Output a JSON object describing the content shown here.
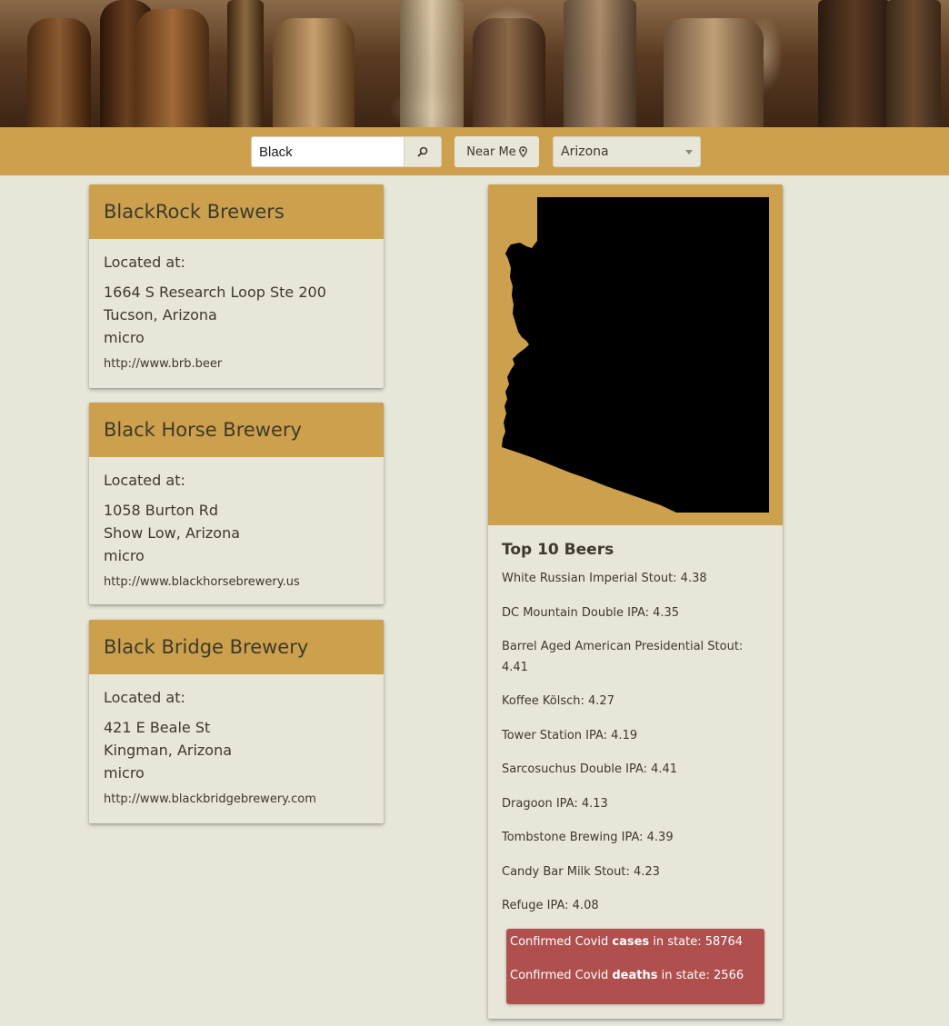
{
  "search": {
    "value": "Black"
  },
  "near_me": {
    "label": "Near Me"
  },
  "state_select": {
    "selected": "Arizona"
  },
  "breweries": [
    {
      "name": "BlackRock Brewers",
      "located_label": "Located at:",
      "street": "1664 S Research Loop Ste 200",
      "city_state": "Tucson, Arizona",
      "type": "micro",
      "url": "http://www.brb.beer"
    },
    {
      "name": "Black Horse Brewery",
      "located_label": "Located at:",
      "street": "1058 Burton Rd",
      "city_state": "Show Low, Arizona",
      "type": "micro",
      "url": "http://www.blackhorsebrewery.us"
    },
    {
      "name": "Black Bridge Brewery",
      "located_label": "Located at:",
      "street": "421 E Beale St",
      "city_state": "Kingman, Arizona",
      "type": "micro",
      "url": "http://www.blackbridgebrewery.com"
    }
  ],
  "state_panel": {
    "top_title": "Top 10 Beers",
    "beers": [
      "White Russian Imperial Stout: 4.38",
      "DC Mountain Double IPA: 4.35",
      "Barrel Aged American Presidential Stout: 4.41",
      "Koffee Kölsch: 4.27",
      "Tower Station IPA: 4.19",
      "Sarcosuchus Double IPA: 4.41",
      "Dragoon IPA: 4.13",
      "Tombstone Brewing IPA: 4.39",
      "Candy Bar Milk Stout: 4.23",
      "Refuge IPA: 4.08"
    ],
    "covid": {
      "cases_prefix": "Confirmed Covid",
      "cases_word": "cases",
      "cases_suffix": "in state: 58764",
      "deaths_prefix": "Confirmed Covid",
      "deaths_word": "deaths",
      "deaths_suffix": "in state: 2566"
    }
  },
  "colors": {
    "gold": "#cca04c",
    "background": "#e8e5d9",
    "text": "#3d3a2c",
    "covid_red": "#b0504e"
  }
}
